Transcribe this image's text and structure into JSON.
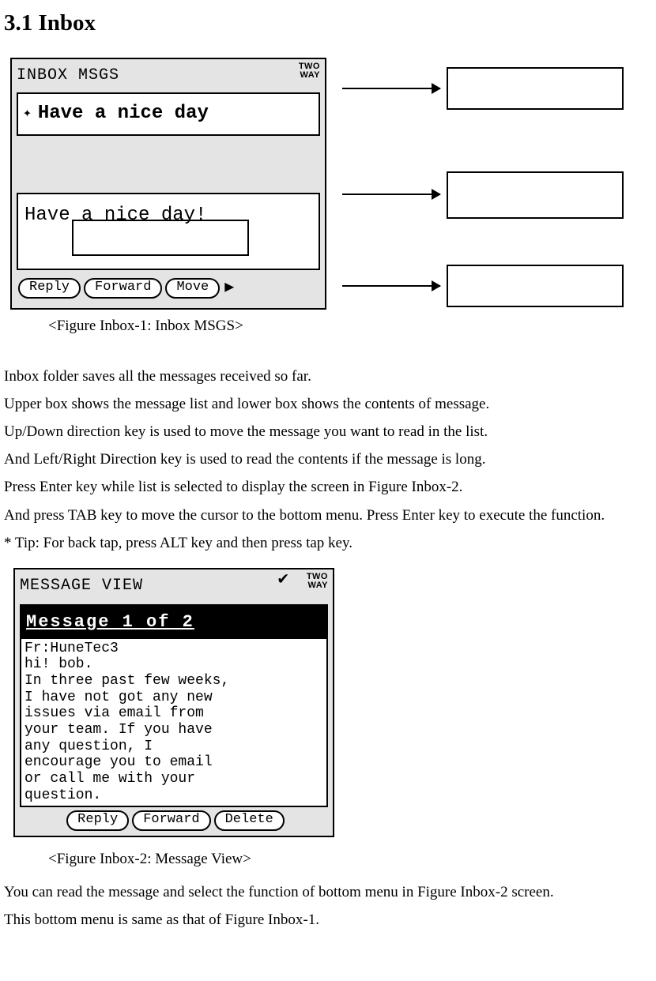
{
  "doc": {
    "heading": "3.1 Inbox",
    "caption1": "<Figure Inbox-1: Inbox MSGS>",
    "caption2": "<Figure Inbox-2: Message View>",
    "paragraphs": [
      "Inbox folder saves all the messages received so far.",
      "Upper box shows the message list and lower box shows the contents of message.",
      "Up/Down direction key is used to move the message you want to read in the list.",
      "And Left/Right Direction key is used to read the contents if the message is long.",
      "Press Enter key while list is selected to display the screen in Figure Inbox-2.",
      "And press TAB key to move the cursor to the bottom menu. Press Enter key to execute the function.",
      "* Tip: For back tap, press ALT key and then press tap key."
    ],
    "after_paragraphs": [
      "You can read the message and select the function of bottom menu in Figure Inbox-2 screen.",
      "This bottom menu is same as that of Figure Inbox-1."
    ]
  },
  "fig1": {
    "title": "INBOX MSGS",
    "two_way_top": "TWO",
    "two_way_bot": "WAY",
    "list_item_icon": "✦",
    "list_item_text": "Have a nice day",
    "preview_text": "Have a nice day!",
    "menu": {
      "reply": "Reply",
      "forward": "Forward",
      "move": "Move",
      "more": "▶"
    }
  },
  "fig2": {
    "title": "MESSAGE VIEW",
    "check": "✔",
    "two_way_top": "TWO",
    "two_way_bot": "WAY",
    "msg_header": "Message  1 of 2",
    "msg_body": "Fr:HuneTec3\nhi! bob.\nIn three past few weeks,\nI have not got any new\nissues via email from\nyour team. If you have\nany question, I\nencourage you to email\nor call me with your\nquestion.",
    "menu": {
      "reply": "Reply",
      "forward": "Forward",
      "del": "Delete"
    }
  }
}
